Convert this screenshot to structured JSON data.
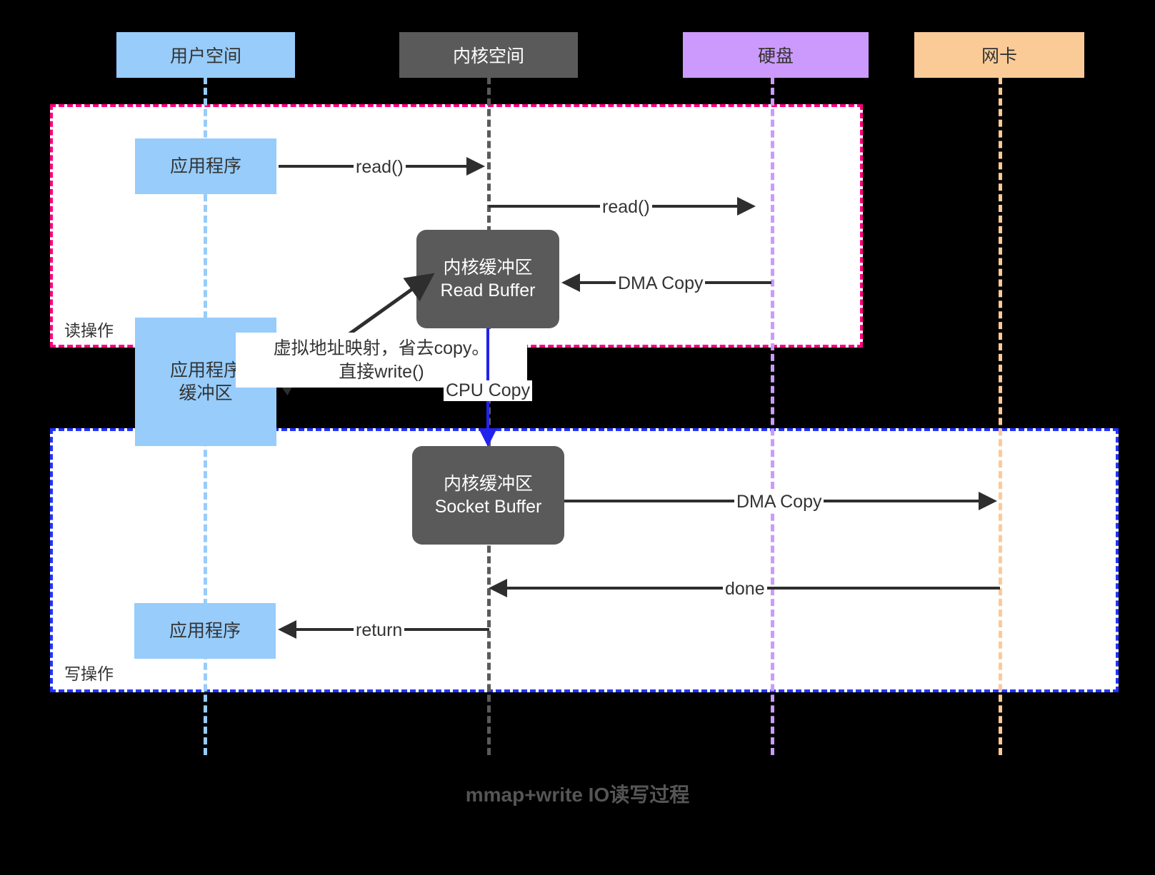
{
  "diagram": {
    "caption": "mmap+write IO读写过程",
    "actors": [
      {
        "id": "user",
        "label": "用户空间",
        "color": "#97ccfb"
      },
      {
        "id": "kernel",
        "label": "内核空间",
        "color": "#5a5a5a"
      },
      {
        "id": "disk",
        "label": "硬盘",
        "color": "#cc9afc"
      },
      {
        "id": "nic",
        "label": "网卡",
        "color": "#fbcb97"
      }
    ],
    "regions": [
      {
        "id": "read",
        "label": "读操作",
        "border_color": "#ff0080"
      },
      {
        "id": "write",
        "label": "写操作",
        "border_color": "#2233ff"
      }
    ],
    "boxes": [
      {
        "id": "app-read",
        "line1": "应用程序",
        "line2": "",
        "style": "blue"
      },
      {
        "id": "read-buffer",
        "line1": "内核缓冲区",
        "line2": "Read Buffer",
        "style": "dark"
      },
      {
        "id": "app-buffer",
        "line1": "应用程序",
        "line2": "缓冲区",
        "style": "blue"
      },
      {
        "id": "socket-buffer",
        "line1": "内核缓冲区",
        "line2": "Socket Buffer",
        "style": "dark"
      },
      {
        "id": "app-return",
        "line1": "应用程序",
        "line2": "",
        "style": "blue"
      }
    ],
    "messages": [
      {
        "id": "read-1",
        "label": "read()",
        "color": "#2e2e2e"
      },
      {
        "id": "read-2",
        "label": "read()",
        "color": "#2e2e2e"
      },
      {
        "id": "dma-copy-in",
        "label": "DMA Copy",
        "color": "#2e2e2e"
      },
      {
        "id": "cpu-copy",
        "label": "CPU Copy",
        "color": "#2222ee"
      },
      {
        "id": "dma-copy-out",
        "label": "DMA Copy",
        "color": "#2e2e2e"
      },
      {
        "id": "done",
        "label": "done",
        "color": "#2e2e2e"
      },
      {
        "id": "return",
        "label": "return",
        "color": "#2e2e2e"
      }
    ],
    "note": {
      "id": "mmap-note",
      "text": "虚拟地址映射，省去copy。\n直接write()"
    }
  }
}
